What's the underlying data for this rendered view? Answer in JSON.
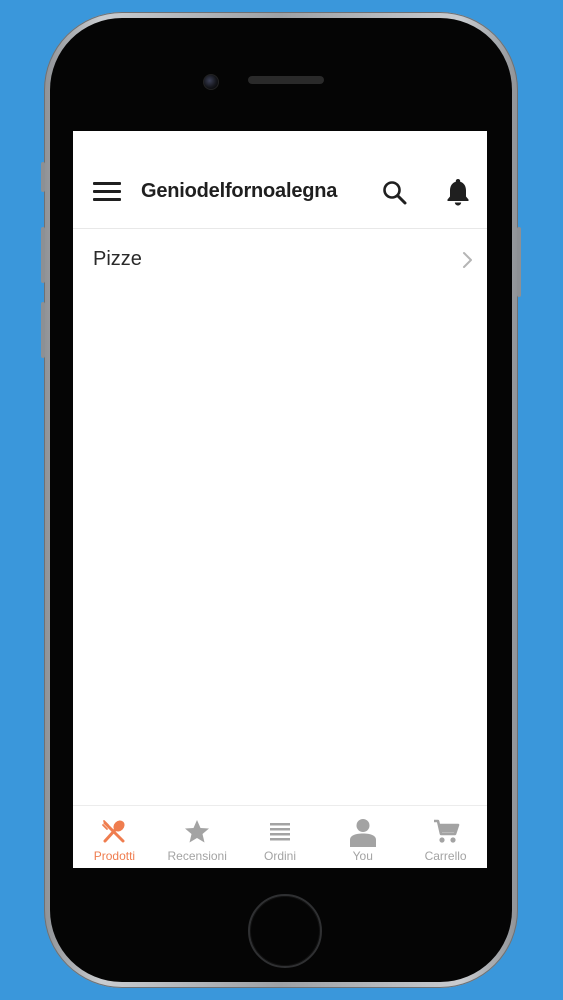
{
  "header": {
    "title": "Geniodelfornoalegna",
    "menu_icon": "hamburger-menu-icon",
    "search_icon": "search-icon",
    "notification_icon": "bell-icon"
  },
  "list": {
    "items": [
      {
        "label": "Pizze",
        "icon": "chevron-right-icon"
      }
    ]
  },
  "tabbar": {
    "active_color": "#ef7d4f",
    "inactive_color": "#a3a3a3",
    "tabs": [
      {
        "label": "Prodotti",
        "icon": "fork-spoon-icon",
        "active": true
      },
      {
        "label": "Recensioni",
        "icon": "star-icon",
        "active": false
      },
      {
        "label": "Ordini",
        "icon": "list-icon",
        "active": false
      },
      {
        "label": "You",
        "icon": "person-icon",
        "active": false
      },
      {
        "label": "Carrello",
        "icon": "cart-icon",
        "active": false
      }
    ]
  },
  "colors": {
    "background": "#3a97db",
    "screen": "#ffffff",
    "text": "#1f1f1f"
  }
}
